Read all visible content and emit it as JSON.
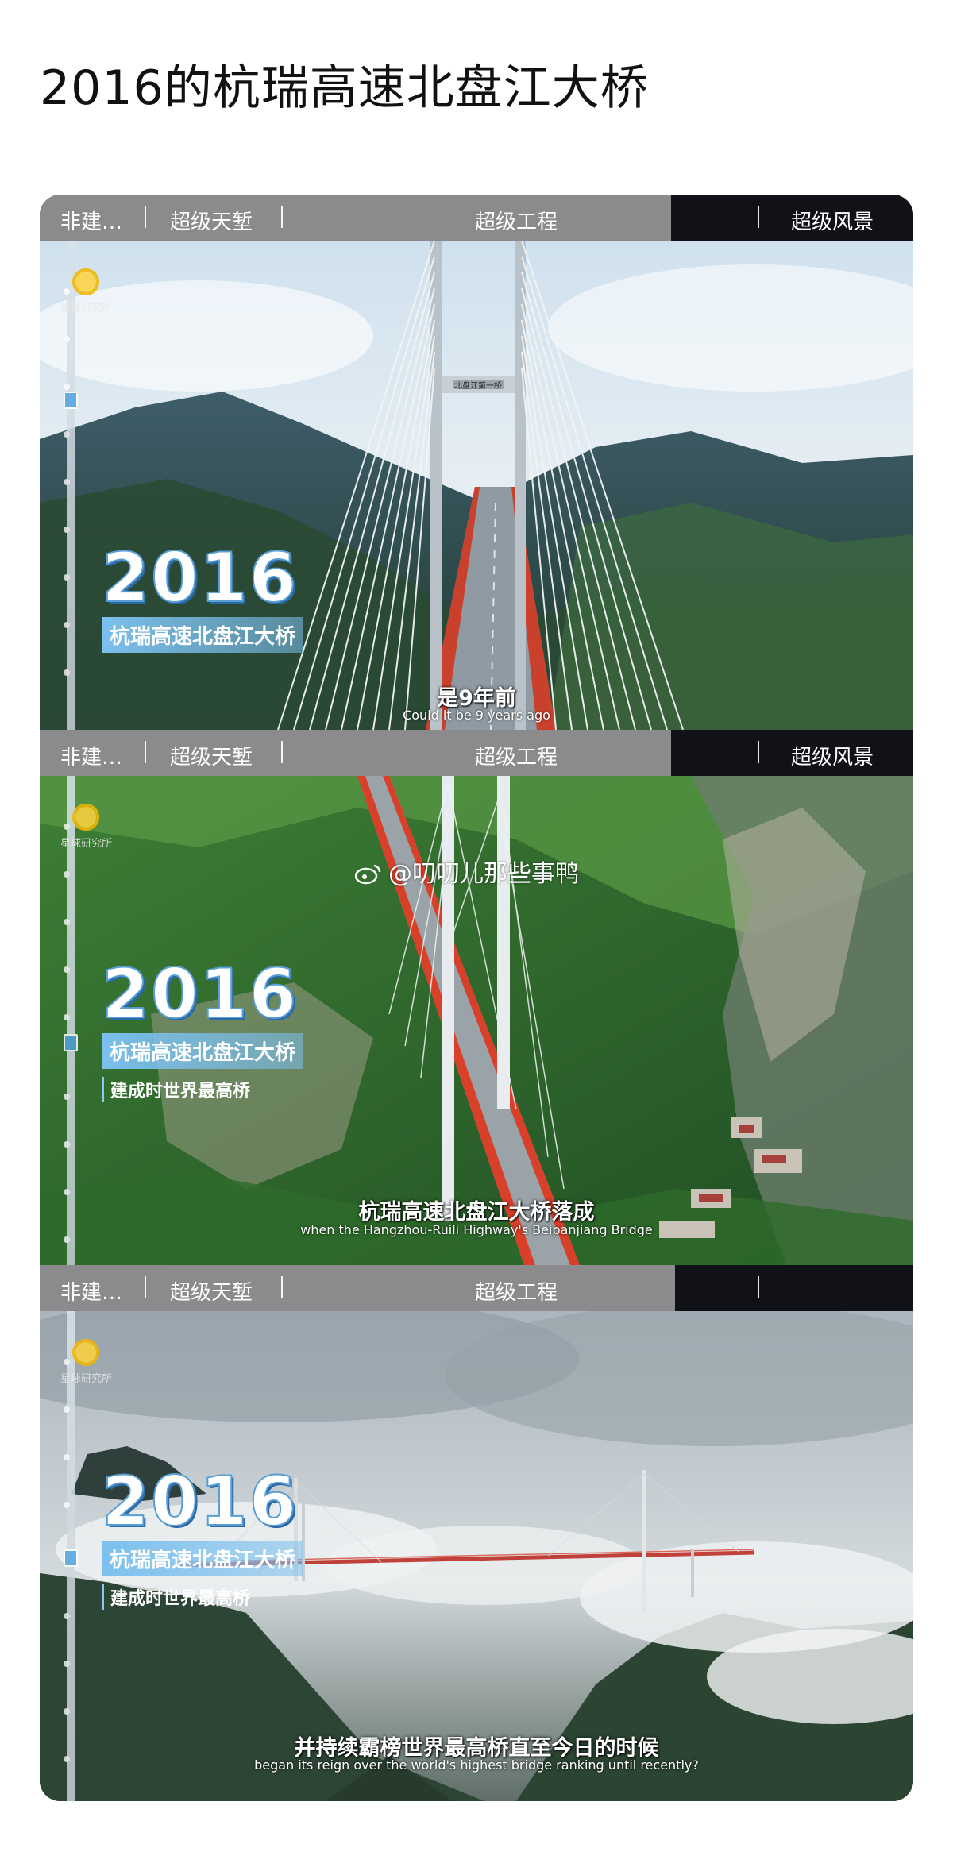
{
  "post": {
    "title": "2016的杭瑞高速北盘江大桥"
  },
  "tabs": {
    "left": "非建…",
    "tianqian": "超级天堑",
    "gongcheng": "超级工程",
    "fengjing": "超级风景"
  },
  "watermark": {
    "channel": "星球研究所",
    "weibo_handle": "@叨叨儿那些事鸭"
  },
  "badge": {
    "year": "2016",
    "bridge_name": "杭瑞高速北盘江大桥",
    "caption": "建成时世界最高桥"
  },
  "subtitles": [
    {
      "cn": "是9年前",
      "en": "Could it be 9 years ago"
    },
    {
      "cn": "杭瑞高速北盘江大桥落成",
      "en": "when the Hangzhou-Ruili Highway's Beipanjiang Bridge"
    },
    {
      "cn": "并持续霸榜世界最高桥直至今日的时候",
      "en": "began its reign over the world's highest bridge ranking until recently?"
    }
  ],
  "bridge_sign": "北盘江第一桥",
  "colors": {
    "tab_gray": "#8b8b8d",
    "tab_dark": "#111217",
    "badge_blue": "#7cc0ee",
    "bridge_red": "#d8402a"
  }
}
